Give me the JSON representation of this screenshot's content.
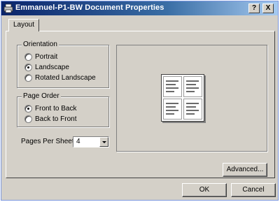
{
  "window": {
    "title": "Emmanuel-P1-BW Document Properties",
    "help_label": "?",
    "close_label": "X"
  },
  "tabs": [
    {
      "label": "Layout",
      "selected": true
    }
  ],
  "orientation": {
    "legend": "Orientation",
    "options": [
      {
        "label": "Portrait",
        "checked": false
      },
      {
        "label": "Landscape",
        "checked": true
      },
      {
        "label": "Rotated Landscape",
        "checked": false
      }
    ]
  },
  "page_order": {
    "legend": "Page Order",
    "options": [
      {
        "label": "Front to Back",
        "checked": true
      },
      {
        "label": "Back to Front",
        "checked": false
      }
    ]
  },
  "pages_per_sheet": {
    "label": "Pages Per Sheet:",
    "value": "4"
  },
  "buttons": {
    "advanced": "Advanced...",
    "ok": "OK",
    "cancel": "Cancel"
  }
}
